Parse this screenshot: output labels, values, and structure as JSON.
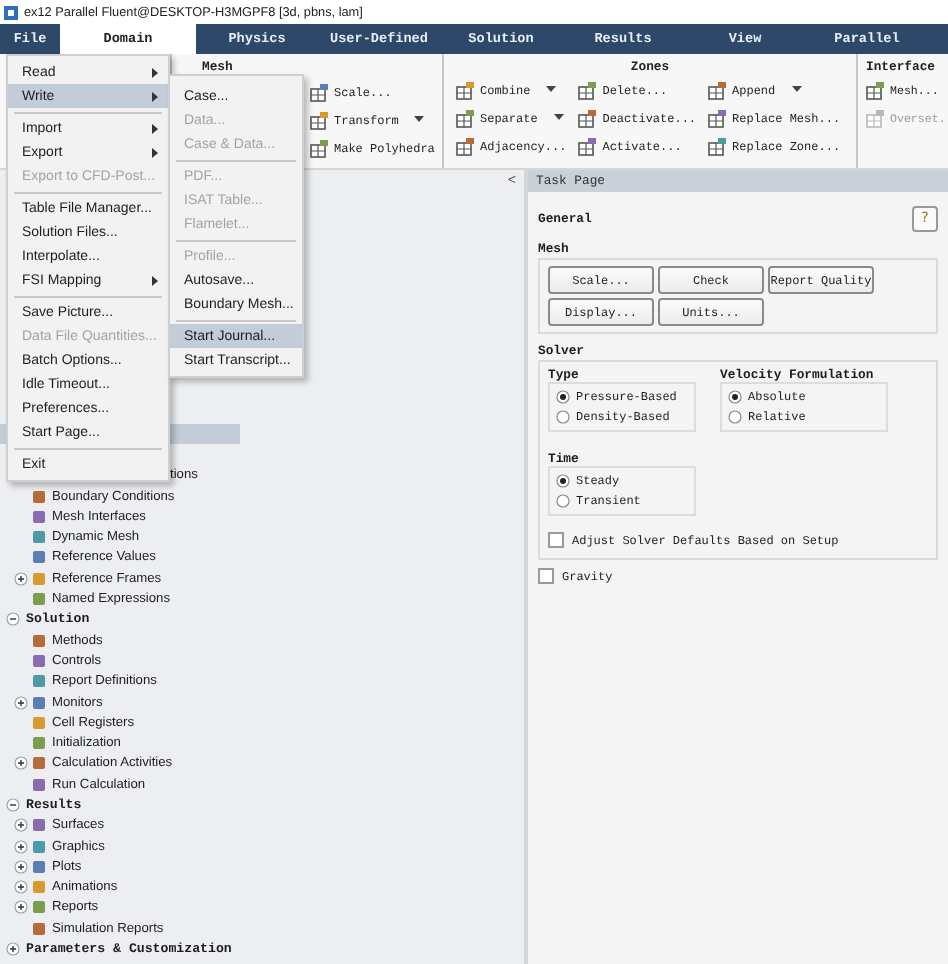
{
  "window": {
    "title": "ex12 Parallel Fluent@DESKTOP-H3MGPF8  [3d, pbns, lam]"
  },
  "tabs": [
    {
      "label": "File",
      "selected": false
    },
    {
      "label": "Domain",
      "selected": true
    },
    {
      "label": "Physics",
      "selected": false
    },
    {
      "label": "User-Defined",
      "selected": false
    },
    {
      "label": "Solution",
      "selected": false
    },
    {
      "label": "Results",
      "selected": false
    },
    {
      "label": "View",
      "selected": false
    },
    {
      "label": "Parallel",
      "selected": false
    }
  ],
  "ribbon": {
    "groups": [
      {
        "title": "Mesh",
        "columns": [
          [
            {
              "label": "Scale...",
              "disabled": false,
              "dropdown": false
            },
            {
              "label": "Transform",
              "disabled": false,
              "dropdown": true
            },
            {
              "label": "Make Polyhedra",
              "disabled": false,
              "dropdown": false
            }
          ]
        ]
      },
      {
        "title": "Zones",
        "columns": [
          [
            {
              "label": "Combine",
              "disabled": false,
              "dropdown": true
            },
            {
              "label": "Separate",
              "disabled": false,
              "dropdown": true
            },
            {
              "label": "Adjacency...",
              "disabled": false,
              "dropdown": false
            }
          ],
          [
            {
              "label": "Delete...",
              "disabled": false,
              "dropdown": false
            },
            {
              "label": "Deactivate...",
              "disabled": false,
              "dropdown": false
            },
            {
              "label": "Activate...",
              "disabled": false,
              "dropdown": false
            }
          ],
          [
            {
              "label": "Append",
              "disabled": false,
              "dropdown": true
            },
            {
              "label": "Replace Mesh...",
              "disabled": false,
              "dropdown": false
            },
            {
              "label": "Replace Zone...",
              "disabled": false,
              "dropdown": false
            }
          ]
        ]
      },
      {
        "title": "Interface",
        "columns": [
          [
            {
              "label": "Mesh...",
              "disabled": false,
              "dropdown": false
            },
            {
              "label": "Overset.",
              "disabled": true,
              "dropdown": false
            }
          ]
        ]
      }
    ]
  },
  "file_menu": {
    "items": [
      {
        "kind": "item",
        "label": "Read",
        "submenu": true,
        "disabled": false,
        "selected": false
      },
      {
        "kind": "item",
        "label": "Write",
        "submenu": true,
        "disabled": false,
        "selected": true
      },
      {
        "kind": "separator"
      },
      {
        "kind": "item",
        "label": "Import",
        "submenu": true,
        "disabled": false,
        "selected": false
      },
      {
        "kind": "item",
        "label": "Export",
        "submenu": true,
        "disabled": false,
        "selected": false
      },
      {
        "kind": "item",
        "label": "Export to CFD-Post...",
        "submenu": false,
        "disabled": true,
        "selected": false
      },
      {
        "kind": "separator"
      },
      {
        "kind": "item",
        "label": "Table File Manager...",
        "submenu": false,
        "disabled": false,
        "selected": false
      },
      {
        "kind": "item",
        "label": "Solution Files...",
        "submenu": false,
        "disabled": false,
        "selected": false
      },
      {
        "kind": "item",
        "label": "Interpolate...",
        "submenu": false,
        "disabled": false,
        "selected": false
      },
      {
        "kind": "item",
        "label": "FSI Mapping",
        "submenu": true,
        "disabled": false,
        "selected": false
      },
      {
        "kind": "separator"
      },
      {
        "kind": "item",
        "label": "Save Picture...",
        "submenu": false,
        "disabled": false,
        "selected": false
      },
      {
        "kind": "item",
        "label": "Data File Quantities...",
        "submenu": false,
        "disabled": true,
        "selected": false
      },
      {
        "kind": "item",
        "label": "Batch Options...",
        "submenu": false,
        "disabled": false,
        "selected": false
      },
      {
        "kind": "item",
        "label": "Idle Timeout...",
        "submenu": false,
        "disabled": false,
        "selected": false
      },
      {
        "kind": "item",
        "label": "Preferences...",
        "submenu": false,
        "disabled": false,
        "selected": false
      },
      {
        "kind": "item",
        "label": "Start Page...",
        "submenu": false,
        "disabled": false,
        "selected": false
      },
      {
        "kind": "separator"
      },
      {
        "kind": "item",
        "label": "Exit",
        "submenu": false,
        "disabled": false,
        "selected": false
      }
    ]
  },
  "write_submenu": {
    "items": [
      {
        "kind": "item",
        "label": "Case...",
        "submenu": false,
        "disabled": false,
        "selected": false
      },
      {
        "kind": "item",
        "label": "Data...",
        "submenu": false,
        "disabled": true,
        "selected": false
      },
      {
        "kind": "item",
        "label": "Case & Data...",
        "submenu": false,
        "disabled": true,
        "selected": false
      },
      {
        "kind": "separator"
      },
      {
        "kind": "item",
        "label": "PDF...",
        "submenu": false,
        "disabled": true,
        "selected": false
      },
      {
        "kind": "item",
        "label": "ISAT Table...",
        "submenu": false,
        "disabled": true,
        "selected": false
      },
      {
        "kind": "item",
        "label": "Flamelet...",
        "submenu": false,
        "disabled": true,
        "selected": false
      },
      {
        "kind": "separator"
      },
      {
        "kind": "item",
        "label": "Profile...",
        "submenu": false,
        "disabled": true,
        "selected": false
      },
      {
        "kind": "item",
        "label": "Autosave...",
        "submenu": false,
        "disabled": false,
        "selected": false
      },
      {
        "kind": "item",
        "label": "Boundary Mesh...",
        "submenu": false,
        "disabled": false,
        "selected": false
      },
      {
        "kind": "separator"
      },
      {
        "kind": "item",
        "label": "Start Journal...",
        "submenu": false,
        "disabled": false,
        "selected": true
      },
      {
        "kind": "item",
        "label": "Start Transcript...",
        "submenu": false,
        "disabled": false,
        "selected": false
      }
    ]
  },
  "outline": {
    "collapse_glyph": "<",
    "tree": [
      {
        "kind": "blank",
        "selected": true
      },
      {
        "kind": "blank",
        "selected": false
      },
      {
        "kind": "partial",
        "label": "tions",
        "selected": false
      },
      {
        "kind": "item",
        "label": "Boundary Conditions",
        "expandable": false,
        "selected": false
      },
      {
        "kind": "item",
        "label": "Mesh Interfaces",
        "expandable": false,
        "selected": false
      },
      {
        "kind": "item",
        "label": "Dynamic Mesh",
        "expandable": false,
        "selected": false
      },
      {
        "kind": "item",
        "label": "Reference Values",
        "expandable": false,
        "selected": false
      },
      {
        "kind": "item",
        "label": "Reference Frames",
        "expandable": true,
        "selected": false
      },
      {
        "kind": "item",
        "label": "Named Expressions",
        "expandable": false,
        "selected": false
      },
      {
        "kind": "section",
        "label": "Solution",
        "expanded": true,
        "selected": false,
        "children": [
          {
            "kind": "item",
            "label": "Methods",
            "expandable": false,
            "selected": false
          },
          {
            "kind": "item",
            "label": "Controls",
            "expandable": false,
            "selected": false
          },
          {
            "kind": "item",
            "label": "Report Definitions",
            "expandable": false,
            "selected": false
          },
          {
            "kind": "item",
            "label": "Monitors",
            "expandable": true,
            "selected": false
          },
          {
            "kind": "item",
            "label": "Cell Registers",
            "expandable": false,
            "selected": false
          },
          {
            "kind": "item",
            "label": "Initialization",
            "expandable": false,
            "selected": false
          },
          {
            "kind": "item",
            "label": "Calculation Activities",
            "expandable": true,
            "selected": false
          },
          {
            "kind": "item",
            "label": "Run Calculation",
            "expandable": false,
            "selected": false
          }
        ]
      },
      {
        "kind": "section",
        "label": "Results",
        "expanded": true,
        "selected": false,
        "children": [
          {
            "kind": "item",
            "label": "Surfaces",
            "expandable": true,
            "selected": false
          },
          {
            "kind": "item",
            "label": "Graphics",
            "expandable": true,
            "selected": false
          },
          {
            "kind": "item",
            "label": "Plots",
            "expandable": true,
            "selected": false
          },
          {
            "kind": "item",
            "label": "Animations",
            "expandable": true,
            "selected": false
          },
          {
            "kind": "item",
            "label": "Reports",
            "expandable": true,
            "selected": false
          },
          {
            "kind": "item",
            "label": "Simulation Reports",
            "expandable": false,
            "selected": false
          }
        ]
      },
      {
        "kind": "section",
        "label": "Parameters & Customization",
        "expanded": false,
        "selected": false
      }
    ]
  },
  "task_page": {
    "header": "Task Page",
    "title": "General",
    "help_glyph": "?",
    "mesh": {
      "title": "Mesh",
      "buttons": [
        "Scale...",
        "Check",
        "Report Quality",
        "Display...",
        "Units..."
      ]
    },
    "solver": {
      "title": "Solver",
      "groups": [
        {
          "title": "Type",
          "options": [
            {
              "label": "Pressure-Based",
              "selected": true
            },
            {
              "label": "Density-Based",
              "selected": false
            }
          ]
        },
        {
          "title": "Velocity Formulation",
          "options": [
            {
              "label": "Absolute",
              "selected": true
            },
            {
              "label": "Relative",
              "selected": false
            }
          ]
        },
        {
          "title": "Time",
          "options": [
            {
              "label": "Steady",
              "selected": true
            },
            {
              "label": "Transient",
              "selected": false
            }
          ]
        }
      ],
      "adjust": {
        "label": "Adjust Solver Defaults Based on Setup",
        "checked": false
      }
    },
    "gravity": {
      "label": "Gravity",
      "checked": false
    }
  }
}
